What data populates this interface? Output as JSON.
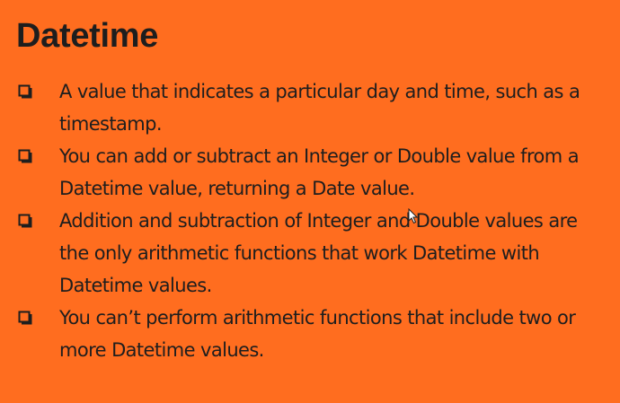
{
  "slide": {
    "title": "Datetime",
    "background_color": "#ff6d1f",
    "bullet_icon": "checkbox-square-icon",
    "bullets": [
      {
        "text": "A value that indicates a particular day and time, such as a timestamp."
      },
      {
        "text": "You can add or subtract an Integer or Double value from a Datetime value, returning a Date value."
      },
      {
        "text": "Addition and subtraction of Integer and Double values are the only arithmetic functions that work Datetime with Datetime values."
      },
      {
        "text": "You can’t perform arithmetic functions that include two or more Datetime values."
      }
    ]
  }
}
